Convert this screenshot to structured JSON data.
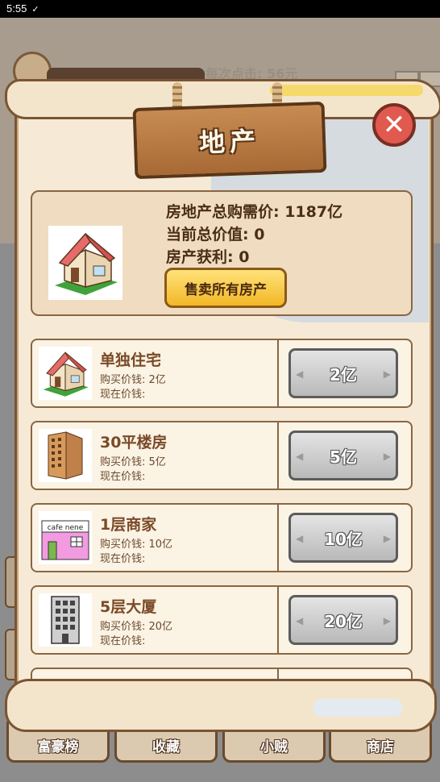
{
  "status_bar": {
    "time": "5:55",
    "check": "✓"
  },
  "background": {
    "banner": "每次点击: 56元"
  },
  "title": "地产",
  "close_icon": "✕",
  "summary": {
    "total_price_label": "房地产总购需价: 1187亿",
    "current_value_label": "当前总价值: 0",
    "profit_label": "房产获利: 0",
    "sell_all_button": "售卖所有房产"
  },
  "properties": [
    {
      "name": "单独住宅",
      "buy": "购买价钱: 2亿",
      "now": "现在价钱:",
      "price": "2亿",
      "icon": "house-icon"
    },
    {
      "name": "30平楼房",
      "buy": "购买价钱: 5亿",
      "now": "现在价钱:",
      "price": "5亿",
      "icon": "apartment-building-icon"
    },
    {
      "name": "1层商家",
      "buy": "购买价钱: 10亿",
      "now": "现在价钱:",
      "price": "10亿",
      "icon": "shop-icon",
      "shop_sign": "cafe nene"
    },
    {
      "name": "5层大厦",
      "buy": "购买价钱: 20亿",
      "now": "现在价钱:",
      "price": "20亿",
      "icon": "office-tower-icon"
    }
  ],
  "bottom_nav": [
    "富豪榜",
    "收藏",
    "小贼",
    "商店"
  ],
  "colors": {
    "parchment": "#f6ead6",
    "wood": "#a86a35",
    "close_red": "#e05a4f",
    "gold_button": "#f2b726",
    "stone_button": "#b9b9b9"
  }
}
